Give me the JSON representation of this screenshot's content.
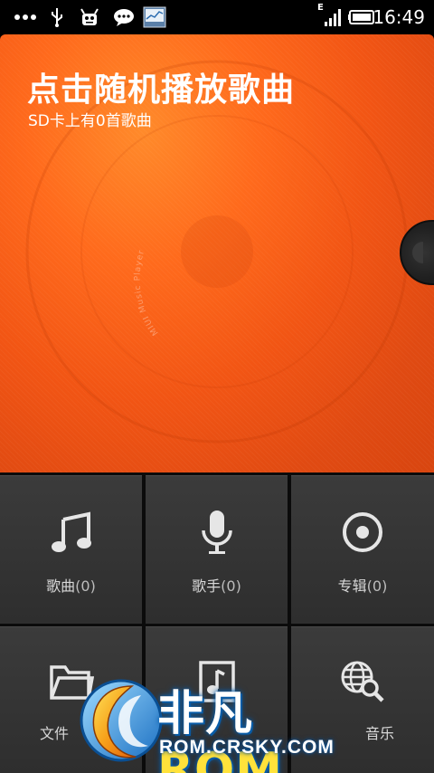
{
  "status_bar": {
    "time": "16:49",
    "network_label": "E",
    "icons": [
      "more-dots-icon",
      "usb-icon",
      "android-debug-icon",
      "chat-icon",
      "stocks-app-icon",
      "signal-icon",
      "battery-icon"
    ]
  },
  "hero": {
    "title": "点击随机播放歌曲",
    "subtitle": "SD卡上有0首歌曲",
    "disc_text": "MIUI Music Player"
  },
  "tiles": [
    {
      "icon": "music-note-icon",
      "label": "歌曲",
      "count": "(0)"
    },
    {
      "icon": "microphone-icon",
      "label": "歌手",
      "count": "(0)"
    },
    {
      "icon": "album-disc-icon",
      "label": "专辑",
      "count": "(0)"
    },
    {
      "icon": "folder-icon",
      "label": "文件",
      "count": ""
    },
    {
      "icon": "playlist-icon",
      "label": "",
      "count": ""
    },
    {
      "icon": "online-search-icon",
      "label": "音乐",
      "count": ""
    }
  ],
  "watermark": {
    "brand_cn": "非凡",
    "brand_rom": "ROM",
    "url": "ROM.CRSKY.COM"
  },
  "colors": {
    "accent_orange": "#f25514",
    "tile_bg": "#333333",
    "watermark_blue": "#0a5da8",
    "watermark_yellow": "#ffe23b"
  }
}
